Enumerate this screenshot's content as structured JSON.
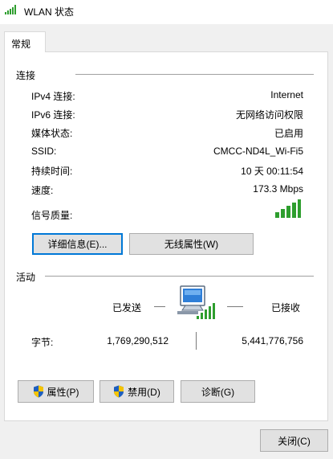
{
  "window": {
    "title": "WLAN 状态"
  },
  "tabs": [
    {
      "label": "常规"
    }
  ],
  "connection": {
    "group_label": "连接",
    "rows": [
      {
        "label": "IPv4 连接:",
        "value": "Internet"
      },
      {
        "label": "IPv6 连接:",
        "value": "无网络访问权限"
      },
      {
        "label": "媒体状态:",
        "value": "已启用"
      },
      {
        "label": "SSID:",
        "value": "CMCC-ND4L_Wi-Fi5"
      },
      {
        "label": "持续时间:",
        "value": "10 天 00:11:54"
      },
      {
        "label": "速度:",
        "value": "173.3 Mbps"
      }
    ],
    "signal_label": "信号质量:",
    "signal_bars": 5,
    "details_button": "详细信息(E)...",
    "wireless_props_button": "无线属性(W)"
  },
  "activity": {
    "group_label": "活动",
    "sent_label": "已发送",
    "received_label": "已接收",
    "bytes_label": "字节:",
    "bytes_sent": "1,769,290,512",
    "bytes_received": "5,441,776,756"
  },
  "buttons": {
    "properties": "属性(P)",
    "disable": "禁用(D)",
    "diagnose": "诊断(G)",
    "close": "关闭(C)"
  },
  "colors": {
    "signal": "#2e9e2e",
    "focus": "#0078d7",
    "shield_blue": "#1e5fbf",
    "shield_yellow": "#f5c400"
  }
}
